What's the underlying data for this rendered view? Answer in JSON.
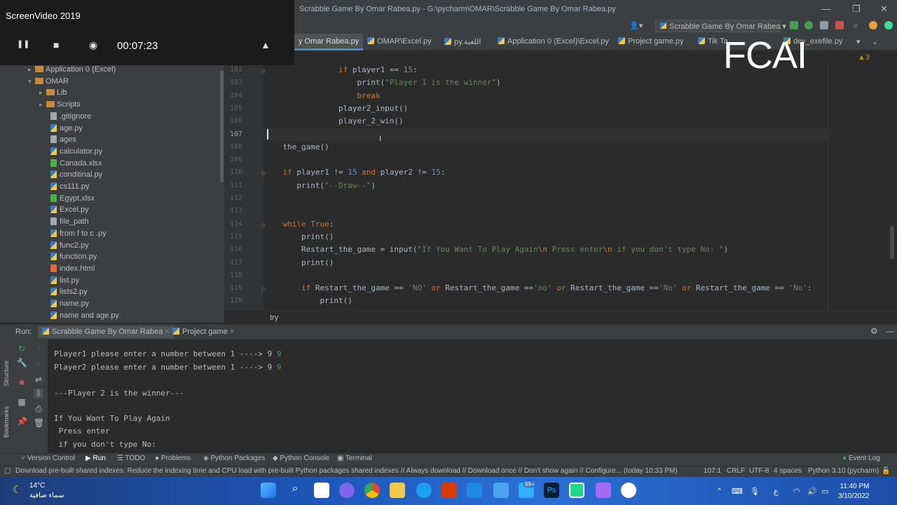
{
  "window": {
    "title": "Scrabble Game By Omar Rabea.py - G:\\pycharm\\OMAR\\Scrabble Game By Omar Rabea.py",
    "controls": [
      "—",
      "❐",
      "✕"
    ]
  },
  "recorder": {
    "title": "ScreenVideo 2019",
    "elapsed": "00:07:23"
  },
  "toolbar": {
    "run_config": "Scrabble Game By Omar Rabea",
    "user_icon": "user-icon"
  },
  "tabs": [
    {
      "label": "y Omar Rabea.py",
      "active": true
    },
    {
      "label": "OMAR\\Excel.py"
    },
    {
      "label": "py.اللعبة"
    },
    {
      "label": "Application 0 (Excel)\\Excel.py"
    },
    {
      "label": "Project game.py"
    },
    {
      "label": "Tik Ta"
    },
    {
      "label": "dev_exefile.py"
    }
  ],
  "overlay_text": "FCAI",
  "inspection": "▲3",
  "project_tree": [
    {
      "label": "Application 0 (Excel)",
      "type": "folder",
      "depth": 1,
      "arrow": "▸"
    },
    {
      "label": "OMAR",
      "type": "folder",
      "depth": 1,
      "arrow": "▾"
    },
    {
      "label": "Lib",
      "type": "folder",
      "depth": 2,
      "arrow": "▸"
    },
    {
      "label": "Scripts",
      "type": "folder",
      "depth": 2,
      "arrow": "▸"
    },
    {
      "label": ".gitignore",
      "type": "txt",
      "depth": 3
    },
    {
      "label": "age.py",
      "type": "py",
      "depth": 3
    },
    {
      "label": "ages",
      "type": "txt",
      "depth": 3
    },
    {
      "label": "calculator.py",
      "type": "py",
      "depth": 3
    },
    {
      "label": "Canada.xlsx",
      "type": "xl",
      "depth": 3
    },
    {
      "label": "conditinal.py",
      "type": "py",
      "depth": 3
    },
    {
      "label": "cs111.py",
      "type": "py",
      "depth": 3
    },
    {
      "label": "Egypt.xlsx",
      "type": "xl",
      "depth": 3
    },
    {
      "label": "Excel.py",
      "type": "py",
      "depth": 3
    },
    {
      "label": "file_path",
      "type": "txt",
      "depth": 3
    },
    {
      "label": "from f to c .py",
      "type": "py",
      "depth": 3
    },
    {
      "label": "func2.py",
      "type": "py",
      "depth": 3
    },
    {
      "label": "function.py",
      "type": "py",
      "depth": 3
    },
    {
      "label": "index.html",
      "type": "html",
      "depth": 3
    },
    {
      "label": "list.py",
      "type": "py",
      "depth": 3
    },
    {
      "label": "lists2.py",
      "type": "py",
      "depth": 3
    },
    {
      "label": "name.py",
      "type": "py",
      "depth": 3
    },
    {
      "label": "name and age.py",
      "type": "py",
      "depth": 3
    }
  ],
  "editor": {
    "line_numbers": [
      "102",
      "103",
      "104",
      "105",
      "106",
      "107",
      "108",
      "109",
      "110",
      "111",
      "112",
      "113",
      "114",
      "115",
      "116",
      "117",
      "118",
      "119",
      "120"
    ],
    "lines": [
      [
        {
          "t": "                ",
          "c": ""
        },
        {
          "t": "if ",
          "c": "kw"
        },
        {
          "t": "player1 == ",
          "c": ""
        },
        {
          "t": "15",
          "c": "num"
        },
        {
          "t": ":",
          "c": ""
        }
      ],
      [
        {
          "t": "                    print(",
          "c": ""
        },
        {
          "t": "\"Player 1 is the winner\"",
          "c": "str"
        },
        {
          "t": ")",
          "c": ""
        }
      ],
      [
        {
          "t": "                    ",
          "c": ""
        },
        {
          "t": "break",
          "c": "kw"
        }
      ],
      [
        {
          "t": "                player2_input()",
          "c": ""
        }
      ],
      [
        {
          "t": "                player_2_win()",
          "c": ""
        }
      ],
      [
        {
          "t": "",
          "c": ""
        }
      ],
      [
        {
          "t": "    the_game()",
          "c": ""
        }
      ],
      [
        {
          "t": "",
          "c": ""
        }
      ],
      [
        {
          "t": "    ",
          "c": ""
        },
        {
          "t": "if ",
          "c": "kw"
        },
        {
          "t": "player1 != ",
          "c": ""
        },
        {
          "t": "15 ",
          "c": "num"
        },
        {
          "t": "and ",
          "c": "kw"
        },
        {
          "t": "player2 != ",
          "c": ""
        },
        {
          "t": "15",
          "c": "num"
        },
        {
          "t": ":",
          "c": ""
        }
      ],
      [
        {
          "t": "       print(",
          "c": ""
        },
        {
          "t": "\"--Draw--\"",
          "c": "str"
        },
        {
          "t": ")",
          "c": ""
        }
      ],
      [
        {
          "t": "",
          "c": ""
        }
      ],
      [
        {
          "t": "",
          "c": ""
        }
      ],
      [
        {
          "t": "    ",
          "c": ""
        },
        {
          "t": "while True",
          "c": "kw"
        },
        {
          "t": ":",
          "c": ""
        }
      ],
      [
        {
          "t": "        print()",
          "c": ""
        }
      ],
      [
        {
          "t": "        Restart_the_game = input(",
          "c": ""
        },
        {
          "t": "\"If You Want To Play Again",
          "c": "str"
        },
        {
          "t": "\\n",
          "c": "esc"
        },
        {
          "t": " Press enter",
          "c": "str"
        },
        {
          "t": "\\n",
          "c": "esc"
        },
        {
          "t": " if you don't type No: \"",
          "c": "str"
        },
        {
          "t": ")",
          "c": ""
        }
      ],
      [
        {
          "t": "        print()",
          "c": ""
        }
      ],
      [
        {
          "t": "",
          "c": ""
        }
      ],
      [
        {
          "t": "        ",
          "c": ""
        },
        {
          "t": "if ",
          "c": "kw"
        },
        {
          "t": "Restart_the_game == ",
          "c": ""
        },
        {
          "t": "'NO' ",
          "c": "str"
        },
        {
          "t": "or ",
          "c": "kw"
        },
        {
          "t": "Restart_the_game ==",
          "c": ""
        },
        {
          "t": "'no' ",
          "c": "str"
        },
        {
          "t": "or ",
          "c": "kw"
        },
        {
          "t": "Restart_the_game ==",
          "c": ""
        },
        {
          "t": "'No' ",
          "c": "str"
        },
        {
          "t": "or ",
          "c": "kw"
        },
        {
          "t": "Restart_the_game == ",
          "c": ""
        },
        {
          "t": "'No'",
          "c": "str"
        },
        {
          "t": ":",
          "c": ""
        }
      ],
      [
        {
          "t": "            print()",
          "c": ""
        }
      ]
    ],
    "breadcrumb": "try"
  },
  "run_panel": {
    "label": "Run:",
    "tabs": [
      "Scrabble Game By Omar Rabea",
      "Project game"
    ],
    "console": [
      {
        "text": "Player1 please enter a number between 1 ----> 9",
        "input": " 9"
      },
      {
        "text": "Player2 please enter a number between 1 ----> 9",
        "input": " 9"
      },
      {
        "text": "",
        "input": ""
      },
      {
        "text": "---Player 2 is the winner---",
        "input": ""
      },
      {
        "text": "",
        "input": ""
      },
      {
        "text": "If You Want To Play Again",
        "input": ""
      },
      {
        "text": " Press enter",
        "input": ""
      },
      {
        "text": " if you don't type No:",
        "input": ""
      }
    ]
  },
  "tool_tabs": [
    "Version Control",
    "Run",
    "TODO",
    "Problems",
    "Python Packages",
    "Python Console",
    "Terminal"
  ],
  "event_log": "Event Log",
  "status": {
    "message": "Download pre-built shared indexes: Reduce the indexing time and CPU load with pre-built Python packages shared indexes // Always download // Download once // Don't show again // Configure... (today 10:33 PM)",
    "position": "107:1",
    "line_sep": "CRLF",
    "encoding": "UTF-8",
    "indent": "4 spaces",
    "interpreter": "Python 3.10 (pycharm)"
  },
  "side_labels": {
    "structure": "Structure",
    "bookmarks": "Bookmarks"
  },
  "taskbar": {
    "weather_temp": "14°C",
    "weather_desc": "سماء صافية",
    "time": "11:40 PM",
    "date": "3/10/2022",
    "badge": "99+",
    "lang": "ع"
  }
}
